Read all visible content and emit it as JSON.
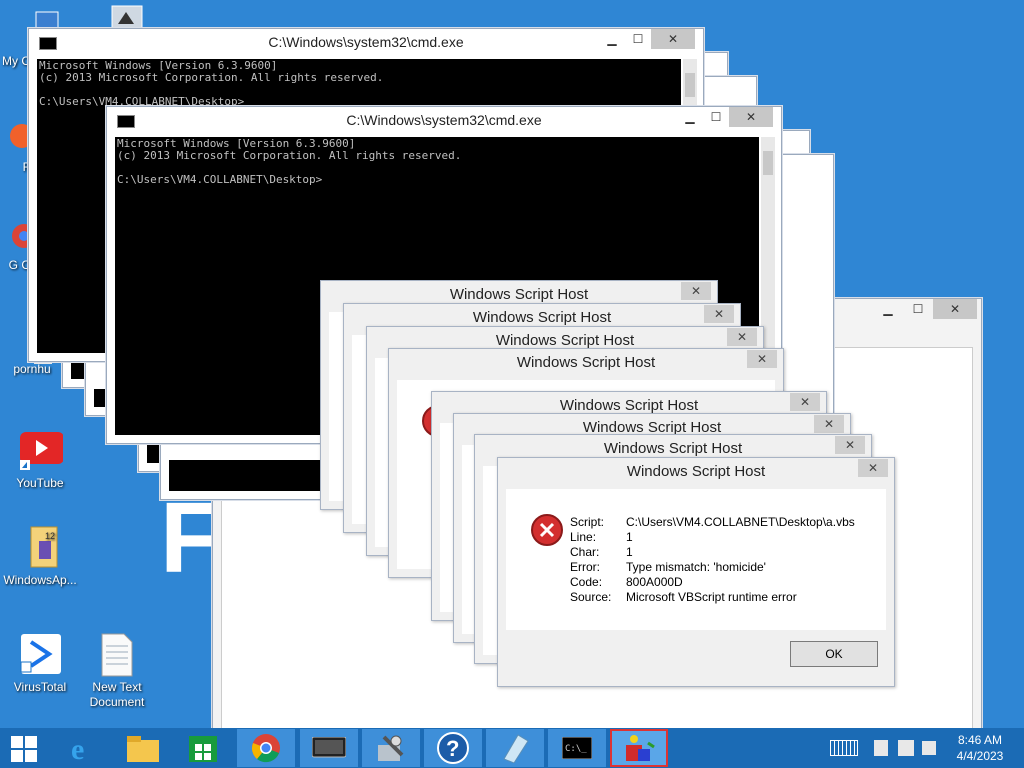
{
  "desktop": {
    "icons": [
      {
        "label": "My C"
      },
      {
        "label": "F"
      },
      {
        "label": "G C"
      },
      {
        "label": "pornhu"
      },
      {
        "label": "YouTube"
      },
      {
        "label": "WindowsAp..."
      },
      {
        "label": "VirusTotal"
      },
      {
        "label": "New Text Document"
      }
    ],
    "background_letter": "F"
  },
  "cmd_windows": [
    {
      "title": "C:\\Windows\\system32\\cmd.exe",
      "content": "Microsoft Windows [Version 6.3.9600]\n(c) 2013 Microsoft Corporation. All rights reserved.\n\nC:\\Users\\VM4.COLLABNET\\Desktop>"
    },
    {
      "title": "C:\\Windows\\system32\\cmd.exe",
      "content": "Microsoft Windows [Version 6.3.9600]\n(c) 2013 Microsoft Corporation. All rights reserved.\n\nC:\\Users\\VM4.COLLABNET\\Desktop>"
    }
  ],
  "dialog": {
    "title": "Windows Script Host",
    "close_glyph": "✕",
    "fields": [
      {
        "label": "Script:",
        "value": "C:\\Users\\VM4.COLLABNET\\Desktop\\a.vbs"
      },
      {
        "label": "Line:",
        "value": "1"
      },
      {
        "label": "Char:",
        "value": "1"
      },
      {
        "label": "Error:",
        "value": "Type mismatch: 'homicide'"
      },
      {
        "label": "Code:",
        "value": "800A000D"
      },
      {
        "label": "Source:",
        "value": "Microsoft VBScript runtime error"
      }
    ],
    "ok_label": "OK"
  },
  "window_controls": {
    "minimize": "▁",
    "maximize": "☐",
    "close": "✕"
  },
  "taskbar": {
    "time": "8:46 AM",
    "date": "4/4/2023",
    "apps": [
      "start-icon",
      "internet-explorer-icon",
      "file-explorer-icon",
      "store-icon",
      "chrome-icon",
      "tablet-icon",
      "tools-icon",
      "help-icon",
      "notepad-icon",
      "cmd-icon",
      "script-host-icon"
    ]
  },
  "colors": {
    "desktop": "#2f86d4",
    "taskbar": "#1b6bb5",
    "error_red": "#d32f2f"
  }
}
